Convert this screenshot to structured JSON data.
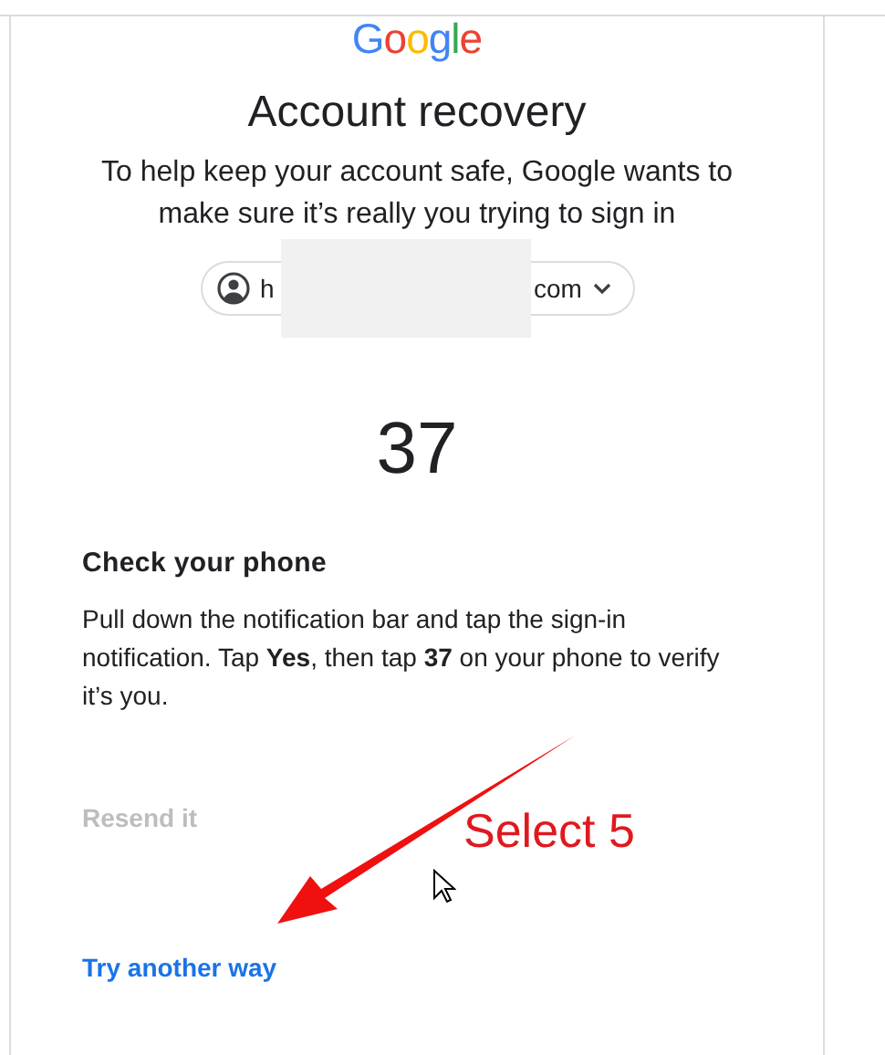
{
  "logo": "Google",
  "title": "Account recovery",
  "subtitle": "To help keep your account safe, Google wants to make sure it’s really you trying to sign in",
  "account_chip": {
    "text_start": "h",
    "text_end": "com"
  },
  "number": "37",
  "section_heading": "Check your phone",
  "instructions": "Pull down the notification bar and tap the sign-in notification. Tap **Yes**, then tap **37** on your phone to verify it’s you.",
  "resend_link": {
    "label": "Resend it",
    "disabled": true
  },
  "try_another_way": "Try another way",
  "annotation": {
    "text": "Select 5"
  }
}
